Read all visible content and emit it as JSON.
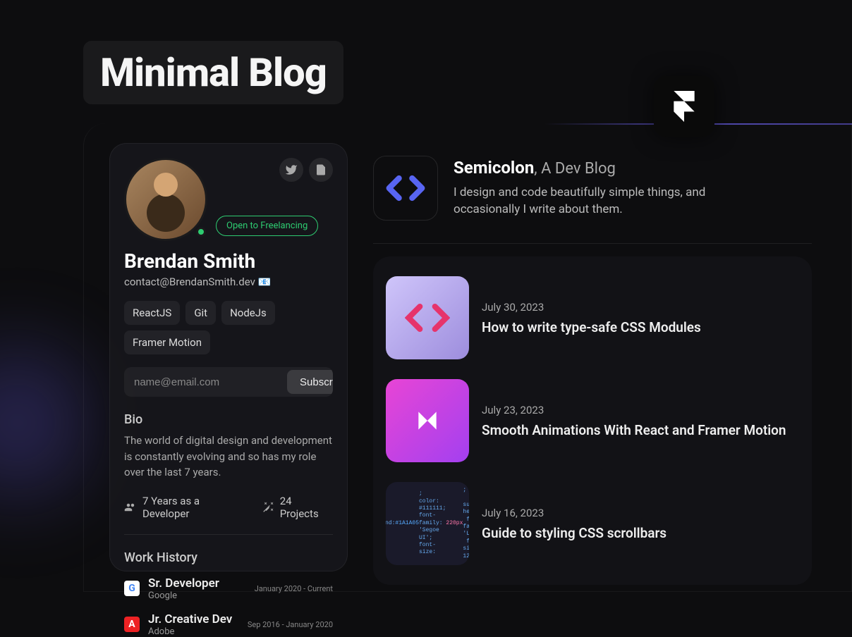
{
  "page_title": "Minimal Blog",
  "profile": {
    "name": "Brendan Smith",
    "email": "contact@BrendanSmith.dev 📧",
    "freelance_badge": "Open to Freelancing",
    "tags": [
      "ReactJS",
      "Git",
      "NodeJs",
      "Framer Motion"
    ],
    "subscribe_placeholder": "name@email.com",
    "subscribe_button": "Subscribe",
    "bio_label": "Bio",
    "bio_text": "The world of digital design and development is constantly evolving and so has my role over the last 7 years.",
    "stat1": "7 Years as a Developer",
    "stat2": "24 Projects",
    "work_history_label": "Work History",
    "work": [
      {
        "role": "Sr. Developer",
        "company": "Google",
        "dates": "January 2020 - Current",
        "logo_bg": "#fff",
        "logo_text": "G",
        "logo_color": "#4285F4"
      },
      {
        "role": "Jr. Creative Dev",
        "company": "Adobe",
        "dates": "Sep 2016 - January 2020",
        "logo_bg": "#ed2224",
        "logo_text": "A",
        "logo_color": "#fff"
      }
    ]
  },
  "blog": {
    "title_bold": "Semicolon",
    "title_sub": ", A Dev Blog",
    "description": "I design and code beautifully simple things, and occasionally I write about them.",
    "posts": [
      {
        "date": "July 30, 2023",
        "title": "How to write type-safe CSS Modules"
      },
      {
        "date": "July 23, 2023",
        "title": "Smooth Animations With React and Framer Motion"
      },
      {
        "date": "July 16, 2023",
        "title": "Guide to styling CSS scrollbars"
      }
    ]
  }
}
